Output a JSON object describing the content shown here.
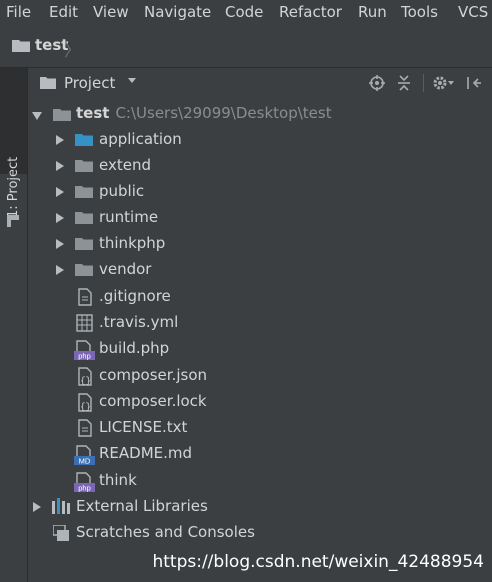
{
  "menubar": {
    "items": [
      "File",
      "Edit",
      "View",
      "Navigate",
      "Code",
      "Refactor",
      "Run",
      "Tools",
      "VCS"
    ]
  },
  "navbar": {
    "project_name": "test",
    "separator": "〉"
  },
  "sidebar": {
    "tab_label": "1: Project"
  },
  "panel": {
    "title": "Project",
    "dropdown": "▾"
  },
  "toolbar": {
    "locate_icon": "⊕",
    "collapse_icon": "⇅",
    "settings_icon": "⚙▾",
    "hide_icon": "⇤"
  },
  "tree": {
    "root": {
      "name": "test",
      "path": "C:\\Users\\29099\\Desktop\\test"
    },
    "folders": [
      "application",
      "extend",
      "public",
      "runtime",
      "thinkphp",
      "vendor"
    ],
    "files": [
      {
        "name": ".gitignore",
        "icon": "text-file-icon"
      },
      {
        "name": ".travis.yml",
        "icon": "yml-file-icon"
      },
      {
        "name": "build.php",
        "icon": "php-file-icon",
        "badge": "php"
      },
      {
        "name": "composer.json",
        "icon": "json-file-icon"
      },
      {
        "name": "composer.lock",
        "icon": "json-file-icon"
      },
      {
        "name": "LICENSE.txt",
        "icon": "text-file-icon"
      },
      {
        "name": "README.md",
        "icon": "md-file-icon",
        "badge": "MD"
      },
      {
        "name": "think",
        "icon": "php-file-icon",
        "badge": "php"
      }
    ],
    "external": "External Libraries",
    "scratches": "Scratches and Consoles"
  },
  "watermark": "https://blog.csdn.net/weixin_42488954",
  "colors": {
    "background": "#3c3f41",
    "folder": "#8c9296",
    "app_folder": "#3592c4",
    "php_badge": "#7b66b5",
    "md_badge": "#3c6eb4"
  }
}
